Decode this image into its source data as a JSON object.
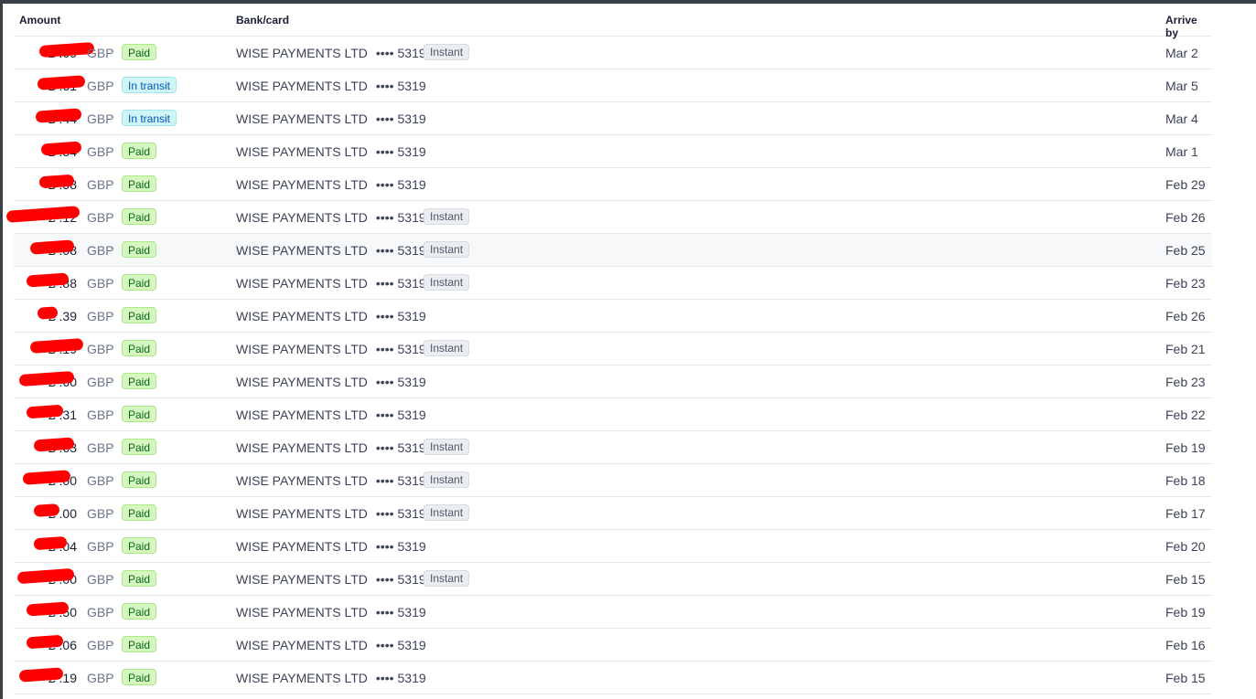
{
  "table": {
    "headers": {
      "amount": "Amount",
      "bank": "Bank/card",
      "arrive": "Arrive by"
    },
    "rows": [
      {
        "amount": "£ .69",
        "currency": "GBP",
        "status": "Paid",
        "bank": "WISE PAYMENTS LTD",
        "dots": "••••",
        "last4": "5319",
        "instant": "Instant",
        "arrive": "Mar 2"
      },
      {
        "amount": "£ .61",
        "currency": "GBP",
        "status": "In transit",
        "bank": "WISE PAYMENTS LTD",
        "dots": "••••",
        "last4": "5319",
        "instant": "",
        "arrive": "Mar 5"
      },
      {
        "amount": "£ .44",
        "currency": "GBP",
        "status": "In transit",
        "bank": "WISE PAYMENTS LTD",
        "dots": "••••",
        "last4": "5319",
        "instant": "",
        "arrive": "Mar 4"
      },
      {
        "amount": "£ .54",
        "currency": "GBP",
        "status": "Paid",
        "bank": "WISE PAYMENTS LTD",
        "dots": "••••",
        "last4": "5319",
        "instant": "",
        "arrive": "Mar 1"
      },
      {
        "amount": "£ .58",
        "currency": "GBP",
        "status": "Paid",
        "bank": "WISE PAYMENTS LTD",
        "dots": "••••",
        "last4": "5319",
        "instant": "",
        "arrive": "Feb 29"
      },
      {
        "amount": "£ .12",
        "currency": "GBP",
        "status": "Paid",
        "bank": "WISE PAYMENTS LTD",
        "dots": "••••",
        "last4": "5319",
        "instant": "Instant",
        "arrive": "Feb 26"
      },
      {
        "amount": "£ .08",
        "currency": "GBP",
        "status": "Paid",
        "bank": "WISE PAYMENTS LTD",
        "dots": "••••",
        "last4": "5319",
        "instant": "Instant",
        "arrive": "Feb 25"
      },
      {
        "amount": "£ .88",
        "currency": "GBP",
        "status": "Paid",
        "bank": "WISE PAYMENTS LTD",
        "dots": "••••",
        "last4": "5319",
        "instant": "Instant",
        "arrive": "Feb 23"
      },
      {
        "amount": "£ .39",
        "currency": "GBP",
        "status": "Paid",
        "bank": "WISE PAYMENTS LTD",
        "dots": "••••",
        "last4": "5319",
        "instant": "",
        "arrive": "Feb 26"
      },
      {
        "amount": "£ .19",
        "currency": "GBP",
        "status": "Paid",
        "bank": "WISE PAYMENTS LTD",
        "dots": "••••",
        "last4": "5319",
        "instant": "Instant",
        "arrive": "Feb 21"
      },
      {
        "amount": "£ .60",
        "currency": "GBP",
        "status": "Paid",
        "bank": "WISE PAYMENTS LTD",
        "dots": "••••",
        "last4": "5319",
        "instant": "",
        "arrive": "Feb 23"
      },
      {
        "amount": "£ .31",
        "currency": "GBP",
        "status": "Paid",
        "bank": "WISE PAYMENTS LTD",
        "dots": "••••",
        "last4": "5319",
        "instant": "",
        "arrive": "Feb 22"
      },
      {
        "amount": "£ .63",
        "currency": "GBP",
        "status": "Paid",
        "bank": "WISE PAYMENTS LTD",
        "dots": "••••",
        "last4": "5319",
        "instant": "Instant",
        "arrive": "Feb 19"
      },
      {
        "amount": "£ .00",
        "currency": "GBP",
        "status": "Paid",
        "bank": "WISE PAYMENTS LTD",
        "dots": "••••",
        "last4": "5319",
        "instant": "Instant",
        "arrive": "Feb 18"
      },
      {
        "amount": "£ .00",
        "currency": "GBP",
        "status": "Paid",
        "bank": "WISE PAYMENTS LTD",
        "dots": "••••",
        "last4": "5319",
        "instant": "Instant",
        "arrive": "Feb 17"
      },
      {
        "amount": "£ .04",
        "currency": "GBP",
        "status": "Paid",
        "bank": "WISE PAYMENTS LTD",
        "dots": "••••",
        "last4": "5319",
        "instant": "",
        "arrive": "Feb 20"
      },
      {
        "amount": "£ .00",
        "currency": "GBP",
        "status": "Paid",
        "bank": "WISE PAYMENTS LTD",
        "dots": "••••",
        "last4": "5319",
        "instant": "Instant",
        "arrive": "Feb 15"
      },
      {
        "amount": "£ .50",
        "currency": "GBP",
        "status": "Paid",
        "bank": "WISE PAYMENTS LTD",
        "dots": "••••",
        "last4": "5319",
        "instant": "",
        "arrive": "Feb 19"
      },
      {
        "amount": "£ .06",
        "currency": "GBP",
        "status": "Paid",
        "bank": "WISE PAYMENTS LTD",
        "dots": "••••",
        "last4": "5319",
        "instant": "",
        "arrive": "Feb 16"
      },
      {
        "amount": "£ .19",
        "currency": "GBP",
        "status": "Paid",
        "bank": "WISE PAYMENTS LTD",
        "dots": "••••",
        "last4": "5319",
        "instant": "",
        "arrive": "Feb 15"
      }
    ]
  },
  "colors": {
    "paid_bg": "#d7f7c2",
    "transit_bg": "#cff5f6",
    "instant_bg": "#ebeef1",
    "redaction": "#ff0000"
  }
}
